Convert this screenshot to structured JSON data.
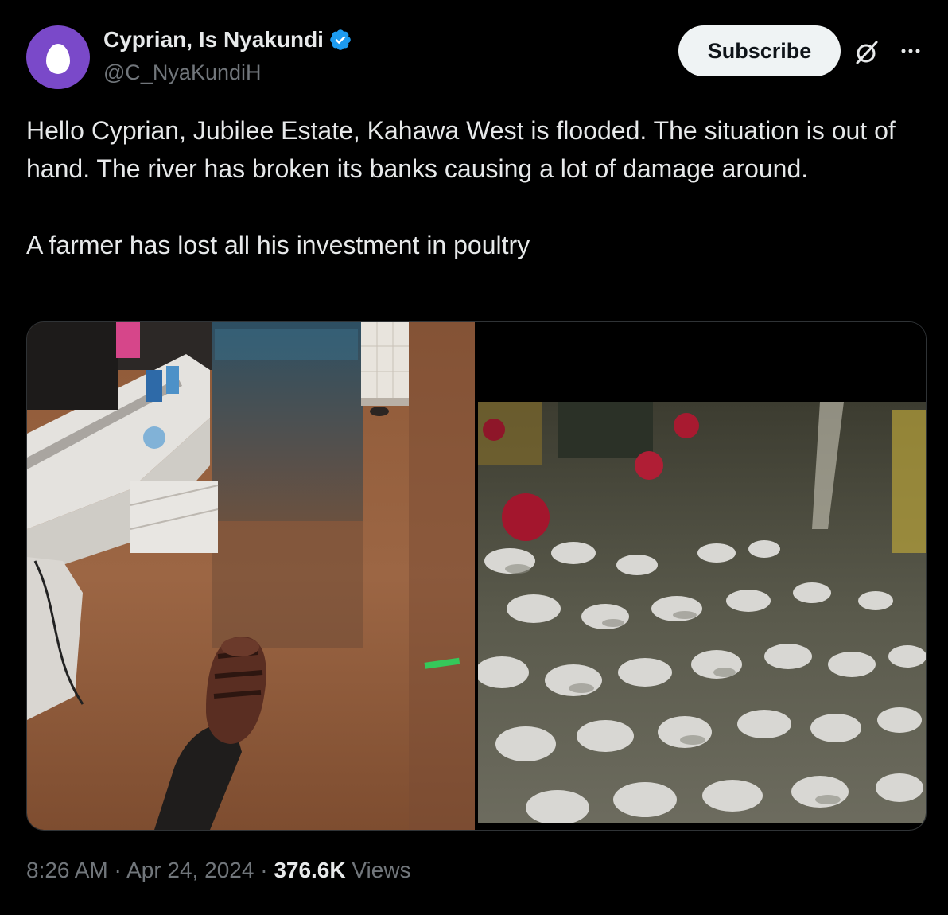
{
  "author": {
    "display_name": "Cyprian, Is Nyakundi",
    "handle": "@C_NyaKundiH",
    "verified": true,
    "avatar_color": "#7a49c9"
  },
  "actions": {
    "subscribe_label": "Subscribe",
    "grok_icon": "grok-icon",
    "more_icon": "more-icon"
  },
  "tweet": {
    "paragraph_1": "Hello Cyprian, Jubilee Estate, Kahawa West is flooded. The situation is out of hand. The river has broken its banks causing a lot of damage around.",
    "paragraph_2": "A farmer has lost all his investment in poultry"
  },
  "meta": {
    "time": "8:26 AM",
    "sep1": " · ",
    "date": "Apr 24, 2024",
    "sep2": " · ",
    "views_count": "376.6K",
    "views_label": " Views"
  },
  "colors": {
    "background": "#000000",
    "text_primary": "#e7e9ea",
    "text_secondary": "#71767b",
    "verified_badge": "#1d9bf0"
  }
}
